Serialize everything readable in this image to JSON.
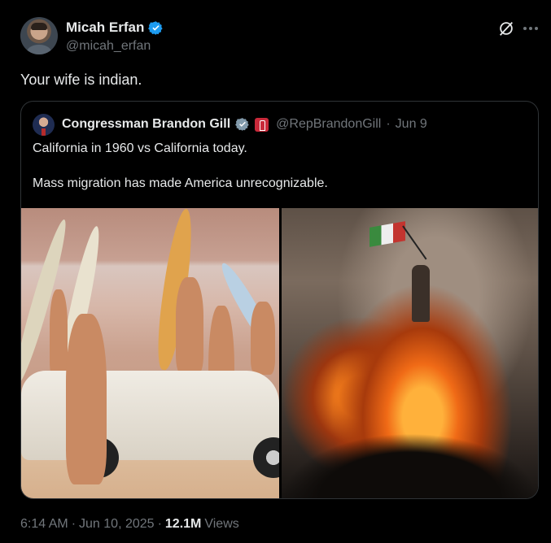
{
  "author": {
    "name": "Micah Erfan",
    "handle": "@micah_erfan"
  },
  "tweet": {
    "text": "Your wife is indian.",
    "time": "6:14 AM",
    "date": "Jun 10, 2025",
    "views_count": "12.1M",
    "views_label": "Views"
  },
  "quoted": {
    "name": "Congressman Brandon Gill",
    "handle": "@RepBrandonGill",
    "separator": "·",
    "date": "Jun 9",
    "line1": "California in 1960 vs California today.",
    "line2": "Mass migration has made America unrecognizable."
  },
  "colors": {
    "background": "#000000",
    "text": "#e7e9ea",
    "muted": "#71767b",
    "verified": "#1d9bf0",
    "gov_verified": "#829aab",
    "border": "#2f3336"
  },
  "icons": [
    "verified-badge-icon",
    "grok-icon",
    "more-icon",
    "gov-verified-badge-icon",
    "house-affiliation-icon"
  ]
}
